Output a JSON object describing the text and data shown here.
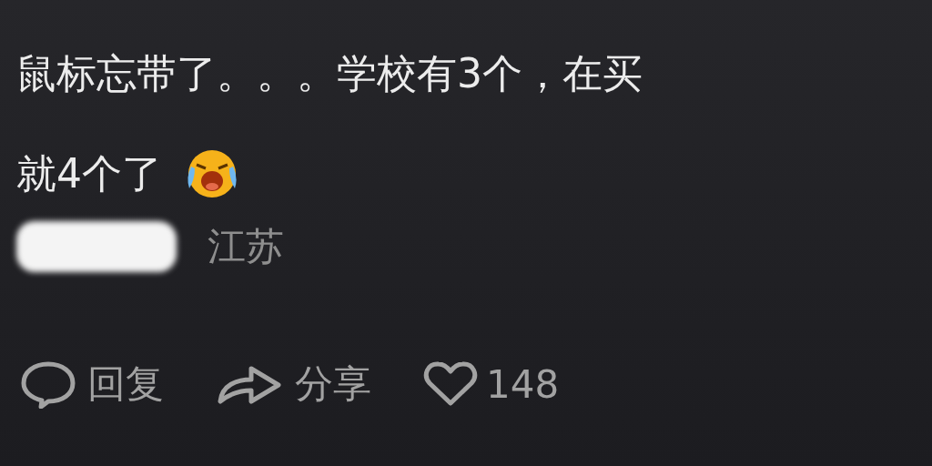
{
  "comment": {
    "text_lines": [
      "鼠标忘带了。。。学校有3个，在买",
      "就4个了"
    ],
    "location": "江苏"
  },
  "actions": [
    {
      "kind": "reply",
      "label": "回复"
    },
    {
      "kind": "share",
      "label": "分享"
    },
    {
      "kind": "like",
      "label": "148"
    }
  ]
}
